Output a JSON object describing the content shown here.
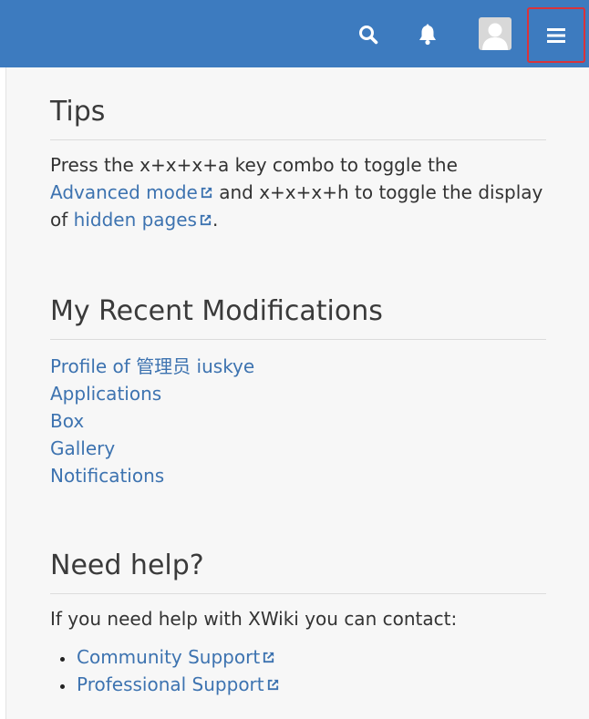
{
  "header": {
    "icons": [
      "search-icon",
      "bell-icon",
      "user-avatar",
      "hamburger-menu-icon"
    ],
    "brand_color": "#3d7bbf",
    "highlight_color": "#d9333a"
  },
  "tips": {
    "title": "Tips",
    "text_1": "Press the x+x+x+a key combo to toggle the ",
    "link_advanced": "Advanced mode",
    "text_2": " and x+x+x+h to toggle the display of ",
    "link_hidden": "hidden pages",
    "text_3": "."
  },
  "recent": {
    "title": "My Recent Modifications",
    "items": [
      "Profile of 管理员 iuskye",
      "Applications",
      "Box",
      "Gallery",
      "Notifications"
    ]
  },
  "help": {
    "title": "Need help?",
    "intro": "If you need help with XWiki you can contact:",
    "links": [
      "Community Support",
      "Professional Support"
    ]
  },
  "colors": {
    "link": "#3d73b0",
    "text": "#333333",
    "panel_bg": "#f7f7f7"
  }
}
